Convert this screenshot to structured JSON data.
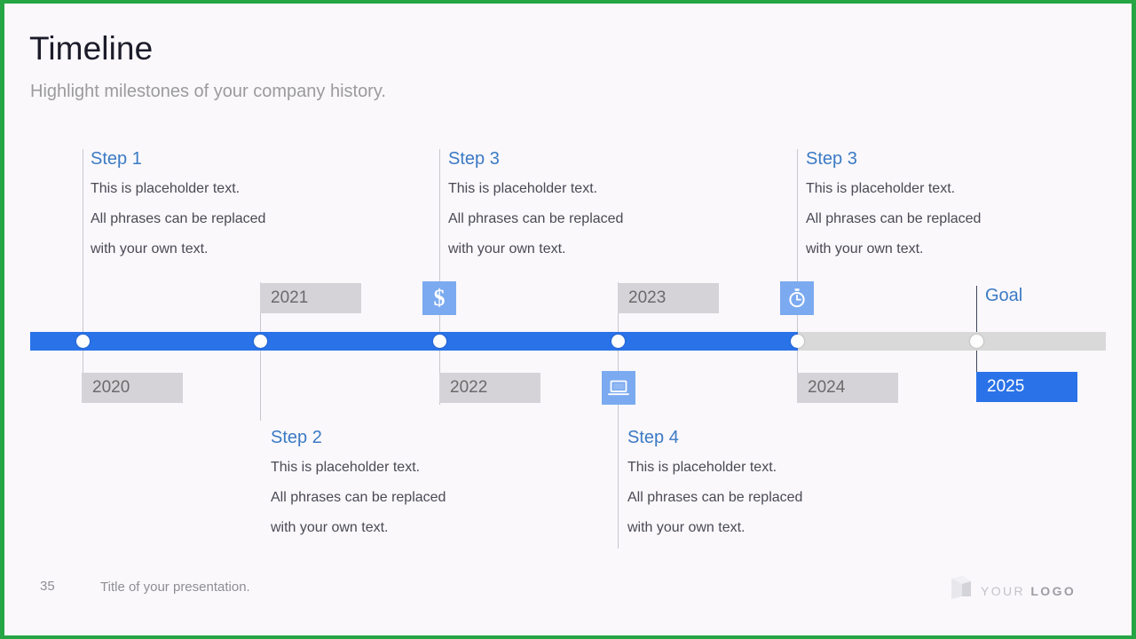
{
  "slide": {
    "title": "Timeline",
    "subtitle": "Highlight milestones of your company history.",
    "border_color": "#26a544",
    "background": "#faf8fb",
    "accent_blue": "#2a72e8",
    "heading_blue": "#3b7ac4",
    "track_gray": "#d9d9d9",
    "chip_gray": "#d6d3d8"
  },
  "timeline": {
    "progress_percent": 71,
    "markers": [
      {
        "year": "2020",
        "position": "above-bar-line",
        "placement": "below"
      },
      {
        "year": "2021",
        "placement": "above"
      },
      {
        "year": "2022",
        "placement": "below"
      },
      {
        "year": "2023",
        "placement": "above"
      },
      {
        "year": "2024",
        "placement": "below"
      },
      {
        "year": "2025",
        "placement": "below",
        "highlight": true
      }
    ],
    "goal_label": "Goal",
    "icons": [
      {
        "name": "dollar-icon",
        "glyph": "$",
        "placement": "above"
      },
      {
        "name": "laptop-icon",
        "glyph": "laptop",
        "placement": "below"
      },
      {
        "name": "stopwatch-icon",
        "glyph": "stopwatch",
        "placement": "above"
      }
    ]
  },
  "steps": [
    {
      "title": "Step 1",
      "line1": "This is placeholder  text.",
      "line2": "All phrases  can be replaced",
      "line3": "with your own text."
    },
    {
      "title": "Step 2",
      "line1": "This is placeholder  text.",
      "line2": "All phrases  can be replaced",
      "line3": "with your own text."
    },
    {
      "title": "Step 3",
      "line1": "This is placeholder  text.",
      "line2": "All phrases  can be replaced",
      "line3": "with your own text."
    },
    {
      "title": "Step 4",
      "line1": "This is placeholder  text.",
      "line2": "All phrases  can be replaced",
      "line3": "with your own text."
    },
    {
      "title": "Step 3",
      "line1": "This is placeholder  text.",
      "line2": "All phrases  can be replaced",
      "line3": "with your own text."
    }
  ],
  "footer": {
    "slide_number": "35",
    "presentation_title": "Title of your presentation.",
    "logo_first": "YOUR",
    "logo_second": "LOGO"
  }
}
